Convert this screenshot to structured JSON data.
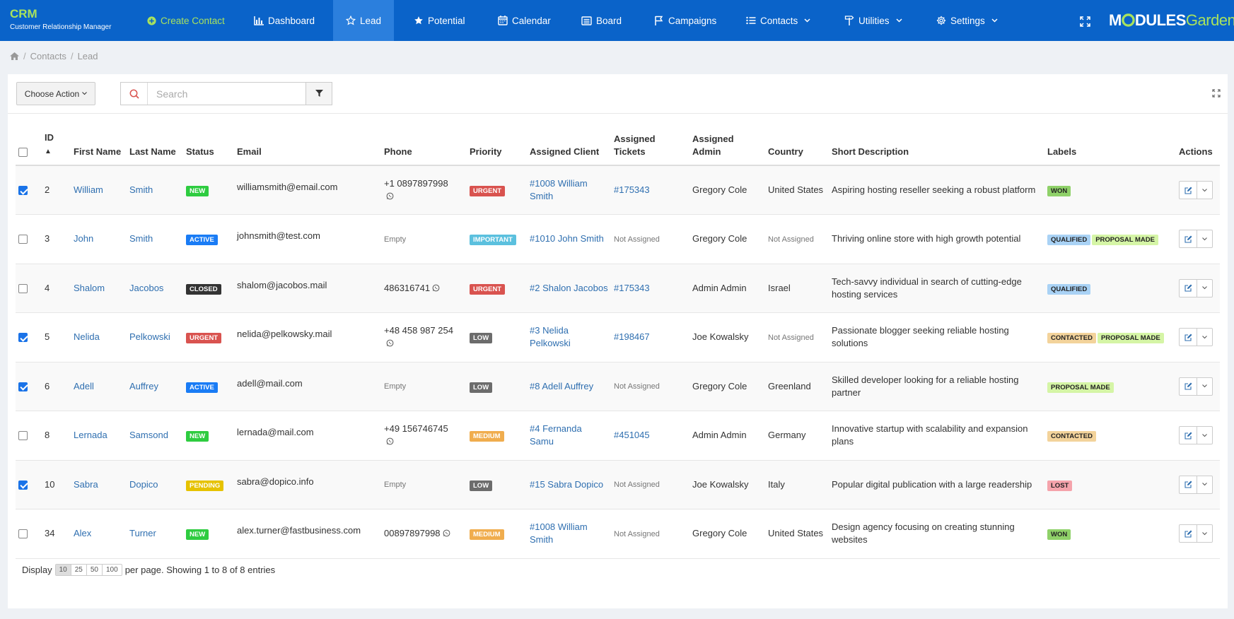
{
  "brand": {
    "title": "CRM",
    "subtitle": "Customer Relationship Manager"
  },
  "nav": {
    "create": "Create Contact",
    "dashboard": "Dashboard",
    "lead": "Lead",
    "potential": "Potential",
    "calendar": "Calendar",
    "board": "Board",
    "campaigns": "Campaigns",
    "contacts": "Contacts",
    "utilities": "Utilities",
    "settings": "Settings"
  },
  "logo": {
    "part1": "M",
    "part2": "DULES",
    "part3": "Garden"
  },
  "breadcrumb": {
    "contacts": "Contacts",
    "current": "Lead"
  },
  "toolbar": {
    "choose_action": "Choose Action",
    "search_placeholder": "Search"
  },
  "columns": {
    "id": "ID",
    "sort_mark": "▲",
    "first_name": "First Name",
    "last_name": "Last Name",
    "status": "Status",
    "email": "Email",
    "phone": "Phone",
    "priority": "Priority",
    "assigned_client": "Assigned Client",
    "assigned_tickets": "Assigned Tickets",
    "assigned_admin": "Assigned Admin",
    "country": "Country",
    "short_description": "Short Description",
    "labels": "Labels",
    "actions": "Actions"
  },
  "rows": [
    {
      "checked": true,
      "id": "2",
      "first": "William",
      "last": "Smith",
      "status": "NEW",
      "email": "williamsmith@email.com",
      "phone": "+1 0897897998",
      "whatsapp": true,
      "priority": "URGENT",
      "client": "#1008 William Smith",
      "ticket": "#175343",
      "admin": "Gregory Cole",
      "country": "United States",
      "description": "Aspiring hosting reseller seeking a robust platform",
      "labels": [
        "WON"
      ]
    },
    {
      "checked": false,
      "id": "3",
      "first": "John",
      "last": "Smith",
      "status": "ACTIVE",
      "email": "johnsmith@test.com",
      "phone": "Empty",
      "whatsapp": false,
      "priority": "IMPORTANT",
      "client": "#1010 John Smith",
      "ticket": "Not Assigned",
      "admin": "Gregory Cole",
      "country": "Not Assigned",
      "description": "Thriving online store with high growth potential",
      "labels": [
        "QUALIFIED",
        "PROPOSAL MADE"
      ]
    },
    {
      "checked": false,
      "id": "4",
      "first": "Shalom",
      "last": "Jacobos",
      "status": "CLOSED",
      "email": "shalom@jacobos.mail",
      "phone": "486316741",
      "whatsapp": true,
      "priority": "URGENT",
      "client": "#2 Shalon Jacobos",
      "ticket": "#175343",
      "admin": "Admin Admin",
      "country": "Israel",
      "description": "Tech-savvy individual in search of cutting-edge hosting services",
      "labels": [
        "QUALIFIED"
      ]
    },
    {
      "checked": true,
      "id": "5",
      "first": "Nelida",
      "last": "Pelkowski",
      "status": "URGENT",
      "email": "nelida@pelkowsky.mail",
      "phone": "+48 458 987 254",
      "whatsapp": true,
      "priority": "LOW",
      "client": "#3 Nelida Pelkowski",
      "ticket": "#198467",
      "admin": "Joe Kowalsky",
      "country": "Not Assigned",
      "description": "Passionate blogger seeking reliable hosting solutions",
      "labels": [
        "CONTACTED",
        "PROPOSAL MADE"
      ]
    },
    {
      "checked": true,
      "id": "6",
      "first": "Adell",
      "last": "Auffrey",
      "status": "ACTIVE",
      "email": "adell@mail.com",
      "phone": "Empty",
      "whatsapp": false,
      "priority": "LOW",
      "client": "#8 Adell Auffrey",
      "ticket": "Not Assigned",
      "admin": "Gregory Cole",
      "country": "Greenland",
      "description": "Skilled developer looking for a reliable hosting partner",
      "labels": [
        "PROPOSAL MADE"
      ]
    },
    {
      "checked": false,
      "id": "8",
      "first": "Lernada",
      "last": "Samsond",
      "status": "NEW",
      "email": "lernada@mail.com",
      "phone": "+49 156746745",
      "whatsapp": true,
      "priority": "MEDIUM",
      "client": "#4 Fernanda Samu",
      "ticket": "#451045",
      "admin": "Admin Admin",
      "country": "Germany",
      "description": "Innovative startup with scalability and expansion plans",
      "labels": [
        "CONTACTED"
      ]
    },
    {
      "checked": true,
      "id": "10",
      "first": "Sabra",
      "last": "Dopico",
      "status": "PENDING",
      "email": "sabra@dopico.info",
      "phone": "Empty",
      "whatsapp": false,
      "priority": "LOW",
      "client": "#15 Sabra Dopico",
      "ticket": "Not Assigned",
      "admin": "Joe Kowalsky",
      "country": "Italy",
      "description": "Popular digital publication with a large readership",
      "labels": [
        "LOST"
      ]
    },
    {
      "checked": false,
      "id": "34",
      "first": "Alex",
      "last": "Turner",
      "status": "NEW",
      "email": "alex.turner@fastbusiness.com",
      "phone": "00897897998",
      "whatsapp": true,
      "priority": "MEDIUM",
      "client": "#1008 William Smith",
      "ticket": "Not Assigned",
      "admin": "Gregory Cole",
      "country": "United States",
      "description": "Design agency focusing on creating stunning websites",
      "labels": [
        "WON"
      ]
    }
  ],
  "footer": {
    "display": "Display",
    "sizes": [
      "10",
      "25",
      "50",
      "100"
    ],
    "summary": "per page. Showing 1 to 8 of 8 entries"
  },
  "colors": {
    "nav_bg": "#0a63c9",
    "nav_active": "#2b7fdd",
    "accent_green": "#a8e25d",
    "link": "#2f6fb0"
  }
}
